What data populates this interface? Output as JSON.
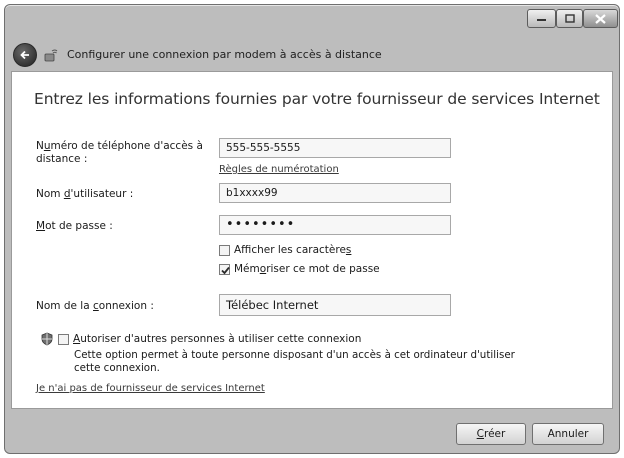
{
  "window": {
    "nav_title": "Configurer une connexion par modem à accès à distance",
    "icons": [
      "minimize-icon",
      "maximize-icon",
      "close-icon",
      "back-arrow-icon",
      "phone-network-icon",
      "shield-icon"
    ]
  },
  "form": {
    "heading": "Entrez les informations fournies par votre fournisseur de services Internet",
    "phone_label_pre": "N",
    "phone_label_acc": "u",
    "phone_label_post": "méro de téléphone d'accès à",
    "phone_label_line2": "distance :",
    "phone_value": "555-555-5555",
    "dialing_rules_link": "Règles de numérotation",
    "username_label_pre": "Nom ",
    "username_label_acc": "d",
    "username_label_post": "'utilisateur :",
    "username_value": "b1xxxx99",
    "password_label_acc": "M",
    "password_label_post": "ot de passe :",
    "password_value": "••••••••",
    "show_chars_pre": "Afficher les caractère",
    "show_chars_acc": "s",
    "show_chars_checked": false,
    "remember_pre": "Mém",
    "remember_acc": "o",
    "remember_post": "riser ce mot de passe",
    "remember_checked": true,
    "conn_name_label_pre": "Nom de la ",
    "conn_name_label_acc": "c",
    "conn_name_label_post": "onnexion :",
    "conn_name_value": "Télébec Internet",
    "allow_others_acc": "A",
    "allow_others_post": "utoriser d'autres personnes à utiliser cette connexion",
    "allow_others_checked": false,
    "allow_others_desc": "Cette option permet à toute personne disposant d'un accès à cet ordinateur d'utiliser cette connexion.",
    "no_isp_link": "Je n'ai pas de fournisseur de services Internet"
  },
  "footer": {
    "create_acc": "C",
    "create_post": "réer",
    "cancel_label": "Annuler"
  }
}
